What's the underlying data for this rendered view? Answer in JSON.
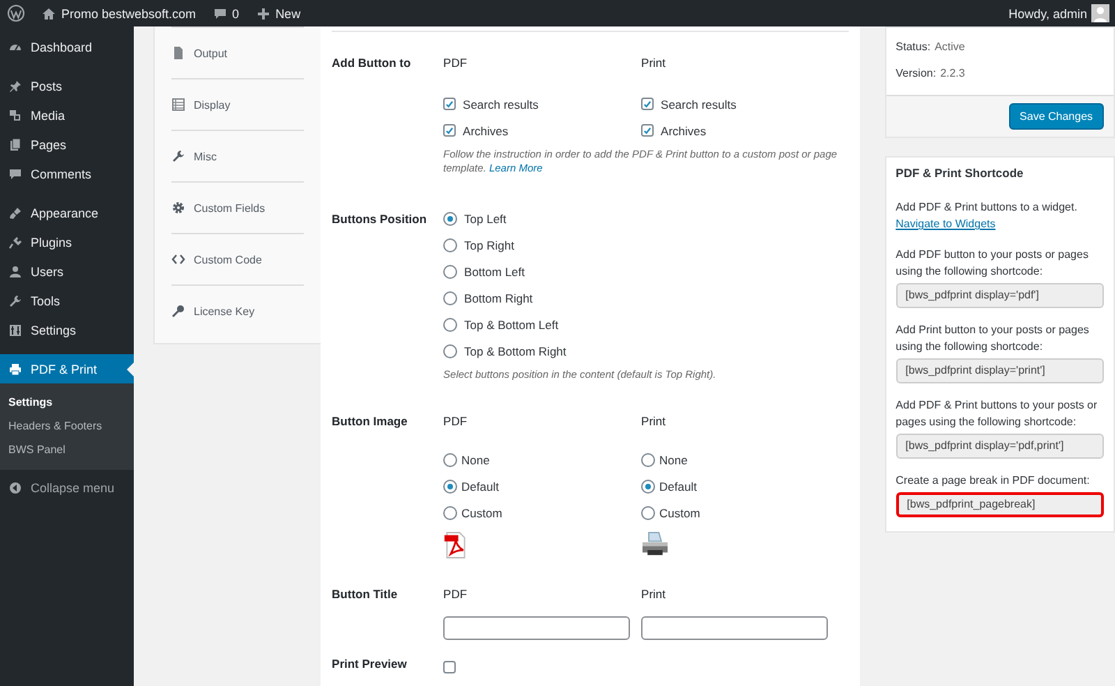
{
  "admin_bar": {
    "site_name": "Promo bestwebsoft.com",
    "comments_count": "0",
    "new_label": "New",
    "greeting": "Howdy, admin"
  },
  "admin_menu": {
    "groups": [
      [
        {
          "label": "Dashboard",
          "selected": false
        }
      ],
      [
        {
          "label": "Posts",
          "selected": false
        },
        {
          "label": "Media",
          "selected": false
        },
        {
          "label": "Pages",
          "selected": false
        },
        {
          "label": "Comments",
          "selected": false
        }
      ],
      [
        {
          "label": "Appearance",
          "selected": false
        },
        {
          "label": "Plugins",
          "selected": false
        },
        {
          "label": "Users",
          "selected": false
        },
        {
          "label": "Tools",
          "selected": false
        },
        {
          "label": "Settings",
          "selected": false
        }
      ],
      [
        {
          "label": "PDF & Print",
          "selected": true,
          "submenu": [
            {
              "label": "Settings",
              "selected": true
            },
            {
              "label": "Headers & Footers",
              "selected": false
            },
            {
              "label": "BWS Panel",
              "selected": false
            }
          ]
        }
      ]
    ],
    "collapse_label": "Collapse menu"
  },
  "settings_tabs": [
    {
      "label": "Output"
    },
    {
      "label": "Display"
    },
    {
      "label": "Misc"
    },
    {
      "label": "Custom Fields"
    },
    {
      "label": "Custom Code"
    },
    {
      "label": "License Key"
    }
  ],
  "settings": {
    "add_button": {
      "label": "Add Button to",
      "columns": [
        {
          "heading": "PDF",
          "options": [
            {
              "label": "Search results",
              "checked": true
            },
            {
              "label": "Archives",
              "checked": true
            }
          ]
        },
        {
          "heading": "Print",
          "options": [
            {
              "label": "Search results",
              "checked": true
            },
            {
              "label": "Archives",
              "checked": true
            }
          ]
        }
      ],
      "note": "Follow the instruction in order to add the PDF & Print button to a custom post or page template.",
      "note_link": "Learn More"
    },
    "position": {
      "label": "Buttons Position",
      "options": [
        {
          "label": "Top Left",
          "selected": true
        },
        {
          "label": "Top Right",
          "selected": false
        },
        {
          "label": "Bottom Left",
          "selected": false
        },
        {
          "label": "Bottom Right",
          "selected": false
        },
        {
          "label": "Top & Bottom Left",
          "selected": false
        },
        {
          "label": "Top & Bottom Right",
          "selected": false
        }
      ],
      "note": "Select buttons position in the content (default is Top Right)."
    },
    "image": {
      "label": "Button Image",
      "columns": [
        {
          "heading": "PDF",
          "kind": "pdf",
          "options": [
            {
              "label": "None",
              "selected": false
            },
            {
              "label": "Default",
              "selected": true
            },
            {
              "label": "Custom",
              "selected": false
            }
          ]
        },
        {
          "heading": "Print",
          "kind": "printer",
          "options": [
            {
              "label": "None",
              "selected": false
            },
            {
              "label": "Default",
              "selected": true
            },
            {
              "label": "Custom",
              "selected": false
            }
          ]
        }
      ]
    },
    "title": {
      "label": "Button Title",
      "columns": [
        {
          "heading": "PDF"
        },
        {
          "heading": "Print"
        }
      ]
    },
    "print_preview": {
      "label": "Print Preview",
      "checked": false
    }
  },
  "sidebar": {
    "status_label": "Status:",
    "status": "Active",
    "version_label": "Version:",
    "version": "2.2.3",
    "save_button": "Save Changes",
    "shortcode_box": {
      "title": "PDF & Print Shortcode",
      "widget_text": "Add PDF & Print buttons to a widget.",
      "widget_link": "Navigate to Widgets",
      "shortcodes": [
        {
          "text": "Add PDF button to your posts or pages using the following shortcode:",
          "code": "[bws_pdfprint display='pdf']",
          "highlighted": false
        },
        {
          "text": "Add Print button to your posts or pages using the following shortcode:",
          "code": "[bws_pdfprint display='print']",
          "highlighted": false
        },
        {
          "text": "Add PDF & Print buttons to your posts or pages using the following shortcode:",
          "code": "[bws_pdfprint display='pdf,print']",
          "highlighted": false
        },
        {
          "text": "Create a page break in PDF document:",
          "code": "[bws_pdfprint_pagebreak]",
          "highlighted": true
        }
      ]
    }
  }
}
